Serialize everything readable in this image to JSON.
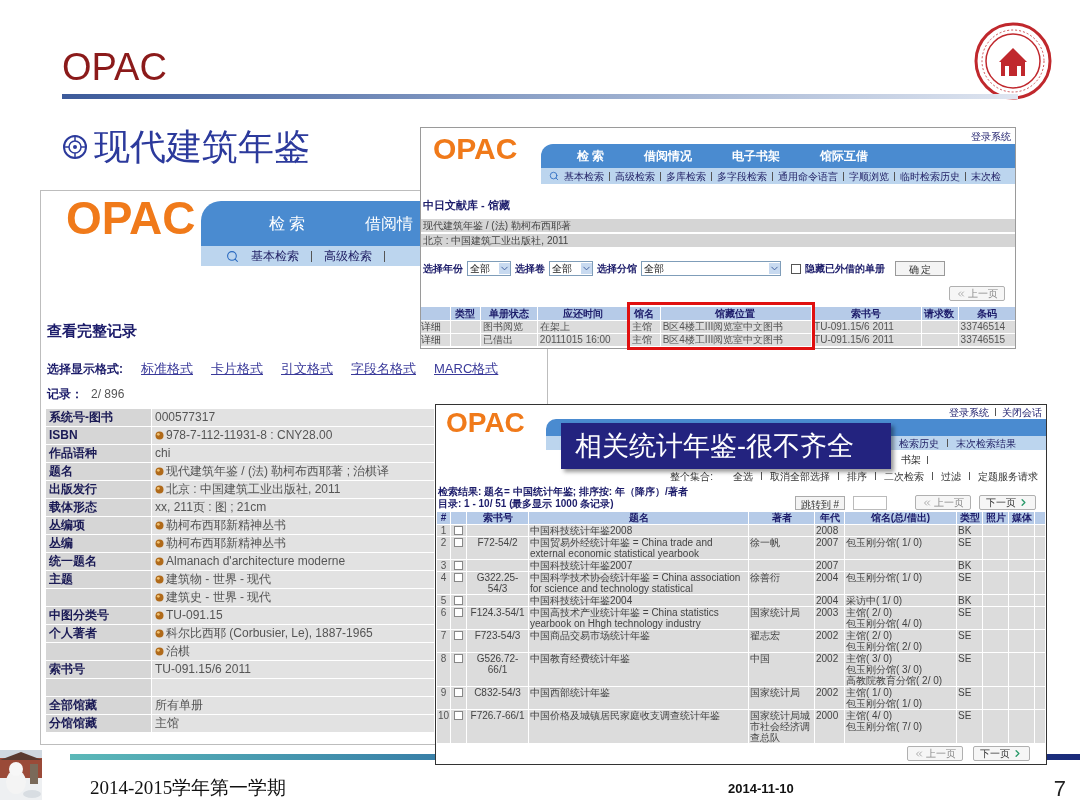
{
  "slide": {
    "title": "OPAC",
    "heading": "现代建筑年鉴"
  },
  "record_window": {
    "logo": "OPAC",
    "nav": [
      "检 索",
      "借阅情"
    ],
    "subnav": [
      "基本检索",
      "高级检索"
    ],
    "title": "查看完整记录",
    "format_label": "选择显示格式:",
    "formats": [
      "标准格式",
      "卡片格式",
      "引文格式",
      "字段名格式",
      "MARC格式"
    ],
    "record_label": "记录：",
    "record_value": "2/ 896",
    "fields": [
      {
        "label": "系统号-图书",
        "value": "000577317",
        "bullet": false
      },
      {
        "label": "ISBN",
        "value": "978-7-112-11931-8 : CNY28.00",
        "bullet": true
      },
      {
        "label": "作品语种",
        "value": "chi",
        "bullet": false
      },
      {
        "label": "题名",
        "value": "现代建筑年鉴 / (法) 勒柯布西耶著 ; 治棋译",
        "bullet": true
      },
      {
        "label": "出版发行",
        "value": "北京 : 中国建筑工业出版社, 2011",
        "bullet": true
      },
      {
        "label": "载体形态",
        "value": "xx, 211页 : 图 ; 21cm",
        "bullet": false
      },
      {
        "label": "丛编项",
        "value": "勒柯布西耶新精神丛书",
        "bullet": true
      },
      {
        "label": "丛编",
        "value": "勒柯布西耶新精神丛书",
        "bullet": true
      },
      {
        "label": "统一题名",
        "value": "Almanach d'architecture moderne",
        "bullet": true
      },
      {
        "label": "主题",
        "value": "建筑物 - 世界 - 现代",
        "bullet": true
      },
      {
        "value": "建筑史 - 世界 - 现代",
        "bullet": true
      },
      {
        "label": "中图分类号",
        "value": "TU-091.15",
        "bullet": true
      },
      {
        "label": "个人著者",
        "value": "科尔比西耶 (Corbusier, Le), 1887-1965",
        "bullet": true
      },
      {
        "value": "治棋",
        "bullet": true
      },
      {
        "label": "索书号",
        "value": "TU-091.15/6 2011",
        "bullet": false
      },
      {
        "bullet": false
      },
      {
        "label": "全部馆藏",
        "value": "所有单册",
        "bullet": false
      },
      {
        "label": "分馆馆藏",
        "value": "主馆",
        "bullet": false
      }
    ]
  },
  "holdings_window": {
    "login": "登录系统",
    "logo": "OPAC",
    "nav": [
      "检 索",
      "借阅情况",
      "电子书架",
      "馆际互借"
    ],
    "subnav": [
      "基本检索",
      "高级检索",
      "多库检索",
      "多字段检索",
      "通用命令语言",
      "字顺浏览",
      "临时检索历史",
      "末次检"
    ],
    "title": "中日文献库 - 馆藏",
    "summary": [
      "现代建筑年鉴 / (法) 勒柯布西耶著",
      "北京 : 中国建筑工业出版社, 2011"
    ],
    "filters": [
      {
        "label": "选择年份",
        "value": "全部"
      },
      {
        "label": "选择卷",
        "value": "全部"
      },
      {
        "label": "选择分馆",
        "value": "全部"
      }
    ],
    "hide_checkbox": {
      "label": "隐藏已外借的单册",
      "checked": false
    },
    "confirm_button": "确 定",
    "prev_button": "上一页",
    "columns": [
      "类型",
      "单册状态",
      "应还时间",
      "馆名",
      "馆藏位置",
      "索书号",
      "请求数",
      "条码"
    ],
    "rows": [
      {
        "detail": "详细",
        "status": "图书阅览",
        "due": "在架上",
        "library": "主馆",
        "location": "B区4楼工III阅览室中文图书",
        "call_number": "TU-091.15/6 2011",
        "barcode": "33746514"
      },
      {
        "detail": "详细",
        "status": "已借出",
        "due": "20111015 16:00",
        "library": "主馆",
        "location": "B区4楼工III阅览室中文图书",
        "call_number": "TU-091.15/6 2011",
        "barcode": "33746515"
      }
    ]
  },
  "results_window": {
    "login_links": [
      "登录系统",
      "关闭会话"
    ],
    "logo": "OPAC",
    "subnav_visible": [
      "检索历史",
      "末次检索结果"
    ],
    "banner": "相关统计年鉴-很不齐全",
    "toolbar_partial": "书架",
    "set_label": "整个集合:",
    "set_actions": [
      "全选",
      "取消全部选择",
      "排序",
      "二次检索",
      "过滤",
      "定题服务请求"
    ],
    "result_summary": "检索结果: 题名= 中国统计年鉴; 排序按: 年（降序）/著者",
    "catalog": "目录: 1 - 10/ 51 (最多显示 1000 条记录)",
    "jump_button": "跳转到 #",
    "prev_button": "上一页",
    "next_button": "下一页",
    "bottom_prev_button": "上一页",
    "bottom_next_button": "下一页",
    "columns": [
      "#",
      "索书号",
      "题名",
      "著者",
      "年代",
      "馆名(总/借出)",
      "类型",
      "照片",
      "媒体"
    ],
    "rows": [
      {
        "number": "1",
        "checked": false,
        "title": "中国科技统计年鉴2008",
        "year": "2008",
        "type": "BK"
      },
      {
        "number": "2",
        "checked": false,
        "call_number": "F72-54/2",
        "title": "中国贸易外经统计年鉴 = China trade and external economic statistical yearbook",
        "author": "徐一帆",
        "year": "2007",
        "holdings": [
          "包玉刚分馆( 1/ 0)"
        ],
        "type": "SE"
      },
      {
        "number": "3",
        "checked": false,
        "title": "中国科技统计年鉴2007",
        "year": "2007",
        "type": "BK"
      },
      {
        "number": "4",
        "checked": false,
        "call_number": "G322.25-54/3",
        "title": "中国科学技术协会统计年鉴 = China association for science and technology statistical",
        "author": "徐善衍",
        "year": "2004",
        "holdings": [
          "包玉刚分馆( 1/ 0)"
        ],
        "type": "SE"
      },
      {
        "number": "5",
        "checked": false,
        "title": "中国科技统计年鉴2004",
        "year": "2004",
        "holdings": [
          "采访中( 1/ 0)"
        ],
        "type": "BK"
      },
      {
        "number": "6",
        "checked": false,
        "call_number": "F124.3-54/1",
        "title": "中国高技术产业统计年鉴 = China statistics yearbook on Hhgh technology industry",
        "author": "国家统计局",
        "year": "2003",
        "holdings": [
          "主馆( 2/ 0)",
          "包玉刚分馆( 4/ 0)"
        ],
        "type": "SE"
      },
      {
        "number": "7",
        "checked": false,
        "call_number": "F723-54/3",
        "title": "中国商品交易市场统计年鉴",
        "author": "翟志宏",
        "year": "2002",
        "holdings": [
          "主馆( 2/ 0)",
          "包玉刚分馆( 2/ 0)"
        ],
        "type": "SE"
      },
      {
        "number": "8",
        "checked": false,
        "call_number": "G526.72-66/1",
        "title": "中国教育经费统计年鉴",
        "author": "中国",
        "year": "2002",
        "holdings": [
          "主馆( 3/ 0)",
          "包玉刚分馆( 3/ 0)",
          "高教院教育分馆( 2/ 0)"
        ],
        "type": "SE"
      },
      {
        "number": "9",
        "checked": false,
        "call_number": "C832-54/3",
        "title": "中国西部统计年鉴",
        "author": "国家统计局",
        "year": "2002",
        "holdings": [
          "主馆( 1/ 0)",
          "包玉刚分馆( 1/ 0)"
        ],
        "type": "SE"
      },
      {
        "number": "10",
        "checked": false,
        "call_number": "F726.7-66/1",
        "title": "中国价格及城镇居民家庭收支调查统计年鉴",
        "author": "国家统计局城市社会经济调查总队",
        "year": "2000",
        "holdings": [
          "主馆( 4/ 0)",
          "包玉刚分馆( 7/ 0)"
        ],
        "type": "SE"
      }
    ]
  },
  "footer": {
    "term": "2014-2015学年第一学期",
    "date": "2014-11-10",
    "page": "7"
  }
}
